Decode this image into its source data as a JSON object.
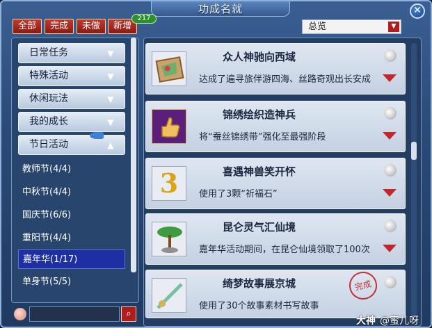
{
  "window": {
    "title": "功成名就",
    "close_label": "✕"
  },
  "filters": {
    "all": "全部",
    "completed": "完成",
    "not_done": "未做",
    "new": "新增",
    "new_count": "217"
  },
  "category_select": {
    "selected": "总览"
  },
  "sidebar": {
    "categories": [
      {
        "label": "日常任务"
      },
      {
        "label": "特殊活动"
      },
      {
        "label": "休闲玩法"
      },
      {
        "label": "我的成长"
      },
      {
        "label": "节日活动"
      }
    ],
    "subitems": [
      {
        "label": "教师节(4/4)"
      },
      {
        "label": "中秋节(4/4)"
      },
      {
        "label": "国庆节(6/6)"
      },
      {
        "label": "重阳节(4/4)"
      },
      {
        "label": "嘉年华(1/17)",
        "selected": true
      },
      {
        "label": "单身节(5/5)"
      }
    ]
  },
  "achievements": [
    {
      "title": "众人神驰向西域",
      "description": "达成了遍寻旅伴游四海、丝路奇观出长安成",
      "icon": "scroll-map-icon"
    },
    {
      "title": "锦绣绘织造神兵",
      "description": "将“蚕丝锦绣带”强化至最强阶段",
      "icon": "thumbs-up-icon"
    },
    {
      "title": "喜遇神兽笑开怀",
      "description": "使用了3颗“祈福石”",
      "icon": "number-three-icon",
      "icon_text": "3"
    },
    {
      "title": "昆仑灵气汇仙境",
      "description": "嘉年华活动期间，在昆仑仙境领取了100次",
      "icon": "green-tree-icon"
    },
    {
      "title": "绮梦故事展京城",
      "description": "使用了30个故事素材书写故事",
      "icon": "jade-sword-icon",
      "stamp": "完成"
    }
  ],
  "watermark": {
    "brand": "大神",
    "user": "@蜜儿呀"
  },
  "colors": {
    "accent_red": "#c3272b",
    "selected_blue": "#1d2fa3",
    "frame_blue": "#2a4a78"
  }
}
